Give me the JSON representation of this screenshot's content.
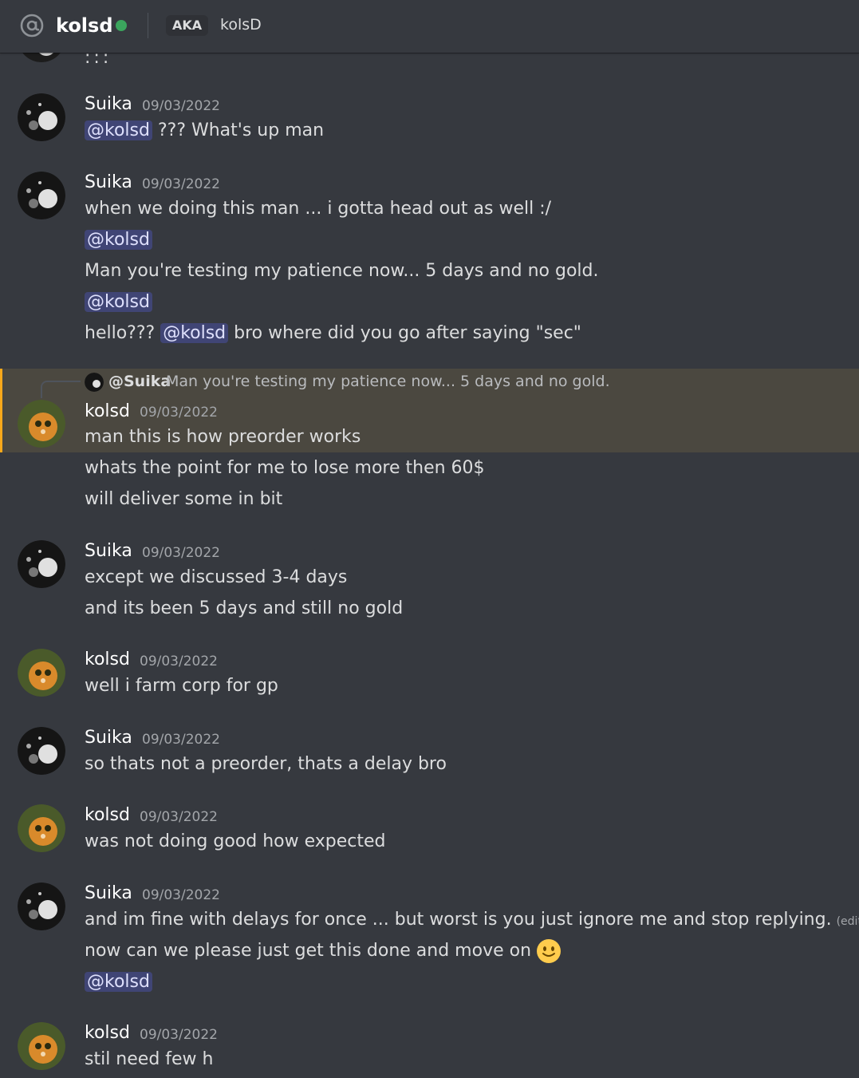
{
  "header": {
    "title": "kolsd",
    "aka_label": "AKA",
    "aka_name": "kolsD",
    "status_color": "#3ba55d"
  },
  "top_partial_text": ":::",
  "messages": [
    {
      "author": "Suika",
      "timestamp": "09/03/2022",
      "lines": [
        {
          "mention": "@kolsd",
          "text": " ??? What's up man"
        }
      ]
    },
    {
      "author": "Suika",
      "timestamp": "09/03/2022",
      "lines": [
        {
          "text": "when we doing this man ... i gotta head out as well :/"
        },
        {
          "mention": "@kolsd"
        },
        {
          "text": "Man you're testing my patience now... 5 days and no gold."
        },
        {
          "mention": "@kolsd"
        },
        {
          "pre": "hello??? ",
          "mention": "@kolsd",
          "text": " bro where did you go after saying \"sec\""
        }
      ]
    },
    {
      "author": "kolsd",
      "timestamp": "09/03/2022",
      "reply": {
        "name": "@Suika",
        "text": "Man you're testing my patience now... 5 days and no gold."
      },
      "lines": [
        {
          "text": "man this is how preorder works"
        },
        {
          "text": "whats the point for me to lose more then 60$"
        },
        {
          "text": "will deliver some in bit"
        }
      ]
    },
    {
      "author": "Suika",
      "timestamp": "09/03/2022",
      "lines": [
        {
          "text": "except we discussed 3-4 days"
        },
        {
          "text": "and its been 5 days and still no gold"
        }
      ]
    },
    {
      "author": "kolsd",
      "timestamp": "09/03/2022",
      "lines": [
        {
          "text": "well i farm corp for gp"
        }
      ]
    },
    {
      "author": "Suika",
      "timestamp": "09/03/2022",
      "lines": [
        {
          "text": "so thats not a preorder, thats a delay bro"
        }
      ]
    },
    {
      "author": "kolsd",
      "timestamp": "09/03/2022",
      "lines": [
        {
          "text": "was not doing good how expected"
        }
      ]
    },
    {
      "author": "Suika",
      "timestamp": "09/03/2022",
      "lines": [
        {
          "text": "and im fine with delays for once ... but worst is you just ignore me and stop replying.",
          "edited": "(edited)"
        },
        {
          "text": "now can we please just get this done and move on",
          "emoji": "slightly-smiling-face-icon"
        },
        {
          "mention": "@kolsd"
        }
      ]
    },
    {
      "author": "kolsd",
      "timestamp": "09/03/2022",
      "lines": [
        {
          "text": "stil need few h"
        }
      ]
    }
  ]
}
